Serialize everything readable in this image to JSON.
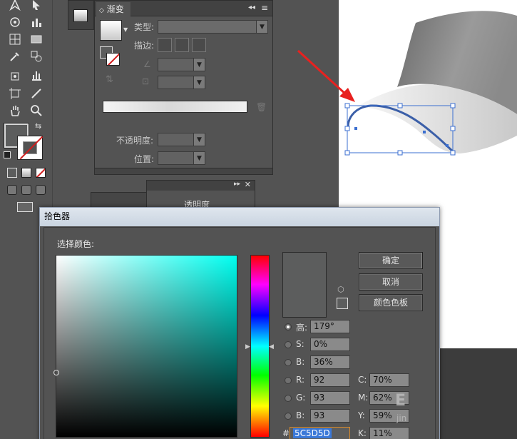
{
  "gradient_panel": {
    "tab_title": "渐变",
    "type_label": "类型:",
    "stroke_label": "描边:",
    "opacity_label": "不透明度:",
    "position_label": "位置:"
  },
  "behind_panel": {
    "tab_text": "透明度"
  },
  "color_picker": {
    "title": "拾色器",
    "select_color_label": "选择颜色:",
    "ok_label": "确定",
    "cancel_label": "取消",
    "swatches_label": "颜色色板",
    "fields": {
      "h_label": "高:",
      "h_value": "179°",
      "s_label": "S:",
      "s_value": "0%",
      "b_label": "B:",
      "b_value": "36%",
      "r_label": "R:",
      "r_value": "92",
      "g_label": "G:",
      "g_value": "93",
      "bl_label": "B:",
      "bl_value": "93",
      "c_label": "C:",
      "c_value": "70%",
      "m_label": "M:",
      "m_value": "62%",
      "y_label": "Y:",
      "y_value": "59%",
      "k_label": "K:",
      "k_value": "11%",
      "hex_label": "#",
      "hex_value": "5C5D5D"
    },
    "current_color": "#5c5d5d"
  },
  "watermark": {
    "text_top": "E",
    "text_bottom": "jin"
  },
  "colors": {
    "accent_arrow": "#e8211f",
    "selection_blue": "#3b6fd0",
    "panel_bg": "#535353"
  }
}
